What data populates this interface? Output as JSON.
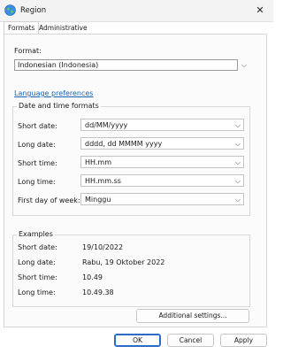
{
  "window": {
    "title": "Region",
    "app_icon": "globe-icon",
    "close_icon": "close-icon"
  },
  "tabs": [
    {
      "label": "Formats",
      "active": true
    },
    {
      "label": "Administrative",
      "active": false
    }
  ],
  "format": {
    "label": "Format:",
    "value": "Indonesian (Indonesia)"
  },
  "language_preferences_link": "Language preferences",
  "date_time": {
    "group_label": "Date and time formats",
    "rows": [
      {
        "label": "Short date:",
        "value": "dd/MM/yyyy"
      },
      {
        "label": "Long date:",
        "value": "dddd, dd MMMM yyyy"
      },
      {
        "label": "Short time:",
        "value": "HH.mm"
      },
      {
        "label": "Long time:",
        "value": "HH.mm.ss"
      },
      {
        "label": "First day of week:",
        "value": "Minggu"
      }
    ]
  },
  "examples": {
    "group_label": "Examples",
    "rows": [
      {
        "label": "Short date:",
        "value": "19/10/2022"
      },
      {
        "label": "Long date:",
        "value": "Rabu, 19 Oktober 2022"
      },
      {
        "label": "Short time:",
        "value": "10.49"
      },
      {
        "label": "Long time:",
        "value": "10.49.38"
      }
    ]
  },
  "additional_settings_label": "Additional settings...",
  "buttons": {
    "ok": "OK",
    "cancel": "Cancel",
    "apply": "Apply"
  },
  "colors": {
    "accent": "#2a6cc8",
    "link": "#1a63b5"
  }
}
